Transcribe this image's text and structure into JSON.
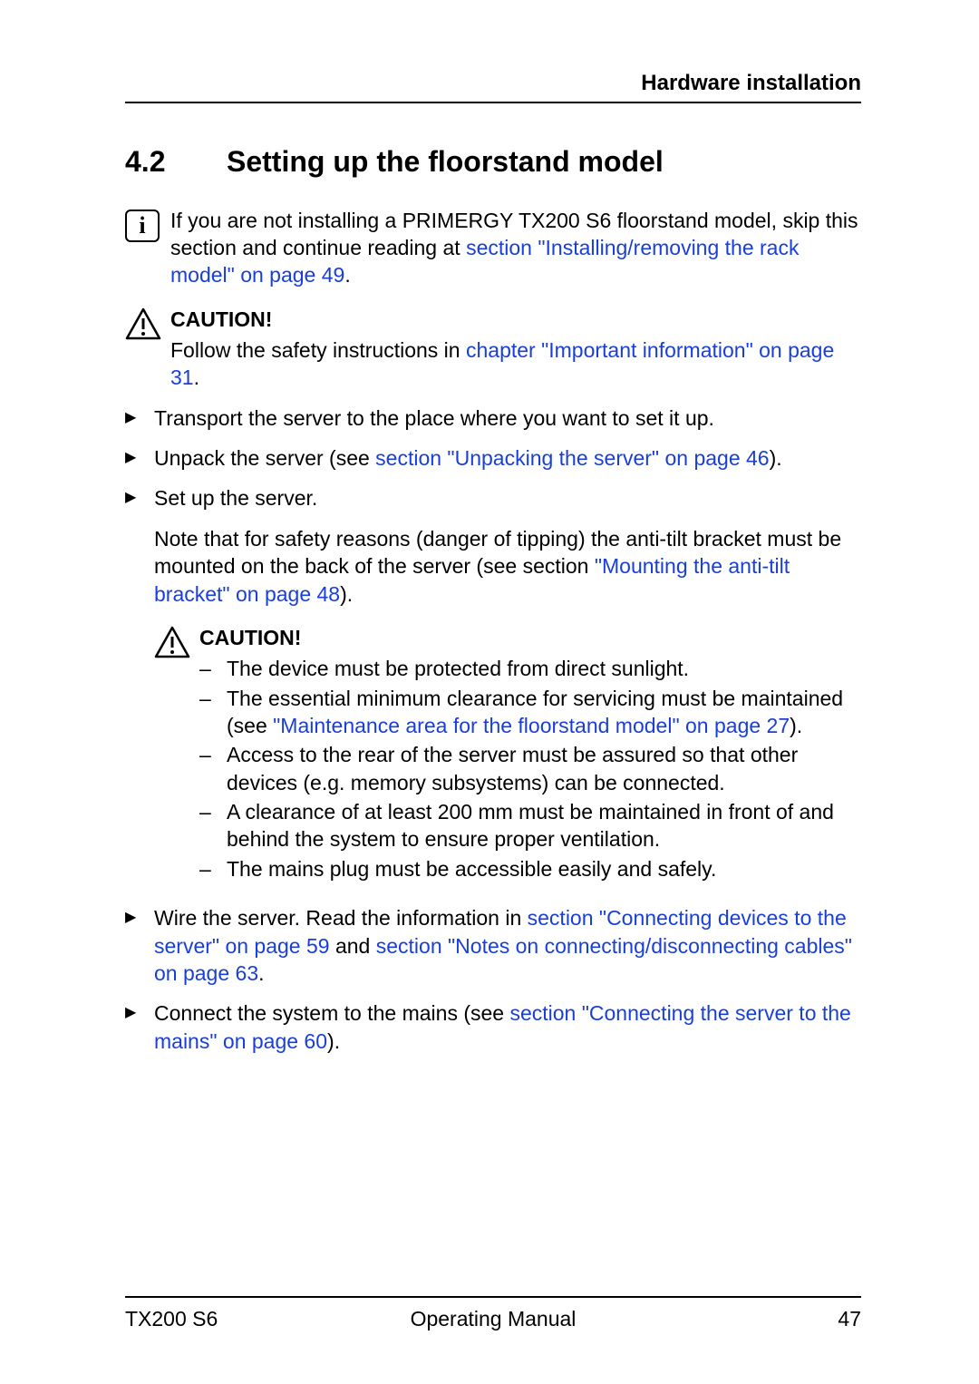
{
  "header": {
    "title": "Hardware installation"
  },
  "section": {
    "number": "4.2",
    "title": "Setting up the floorstand model"
  },
  "info": {
    "text_before": "If you are not installing a PRIMERGY TX200 S6 floorstand model, skip this section and continue reading at ",
    "link": "section \"Installing/removing the rack model\" on page 49",
    "text_after": "."
  },
  "caution1": {
    "label": "CAUTION!",
    "text_before": "Follow the safety instructions in ",
    "link": "chapter \"Important information\" on page 31",
    "text_after": "."
  },
  "steps": {
    "s1": "Transport the server to the place where you want to set it up.",
    "s2_before": "Unpack the server (see ",
    "s2_link": "section \"Unpacking the server\" on page 46",
    "s2_after": ").",
    "s3": "Set up the server.",
    "s3_note_before": "Note that for safety reasons (danger of tipping) the anti-tilt bracket must be mounted on the back of the server (see section ",
    "s3_note_link": "\"Mounting the anti-tilt bracket\" on page 48",
    "s3_note_after": ").",
    "s4_before": "Wire the server. Read the information in ",
    "s4_link1": "section \"Connecting devices to the server\" on page 59",
    "s4_mid": " and ",
    "s4_link2": "section \"Notes on connecting/disconnecting cables\" on page 63",
    "s4_after": ".",
    "s5_before": "Connect the system to the mains (see ",
    "s5_link": "section \"Connecting the server to the mains\" on page 60",
    "s5_after": ")."
  },
  "caution2": {
    "label": "CAUTION!",
    "items": {
      "i1": "The device must be protected from direct sunlight.",
      "i2_before": "The essential minimum clearance for servicing must be maintained (see ",
      "i2_link": "\"Maintenance area for the floorstand model\" on page 27",
      "i2_after": ").",
      "i3": "Access to the rear of the server must be assured so that other devices (e.g. memory subsystems) can be connected.",
      "i4": "A clearance of at least 200 mm must be maintained in front of and behind the system to ensure proper ventilation.",
      "i5": "The mains plug must be accessible easily and safely."
    }
  },
  "footer": {
    "left": "TX200 S6",
    "center": "Operating Manual",
    "right": "47"
  }
}
